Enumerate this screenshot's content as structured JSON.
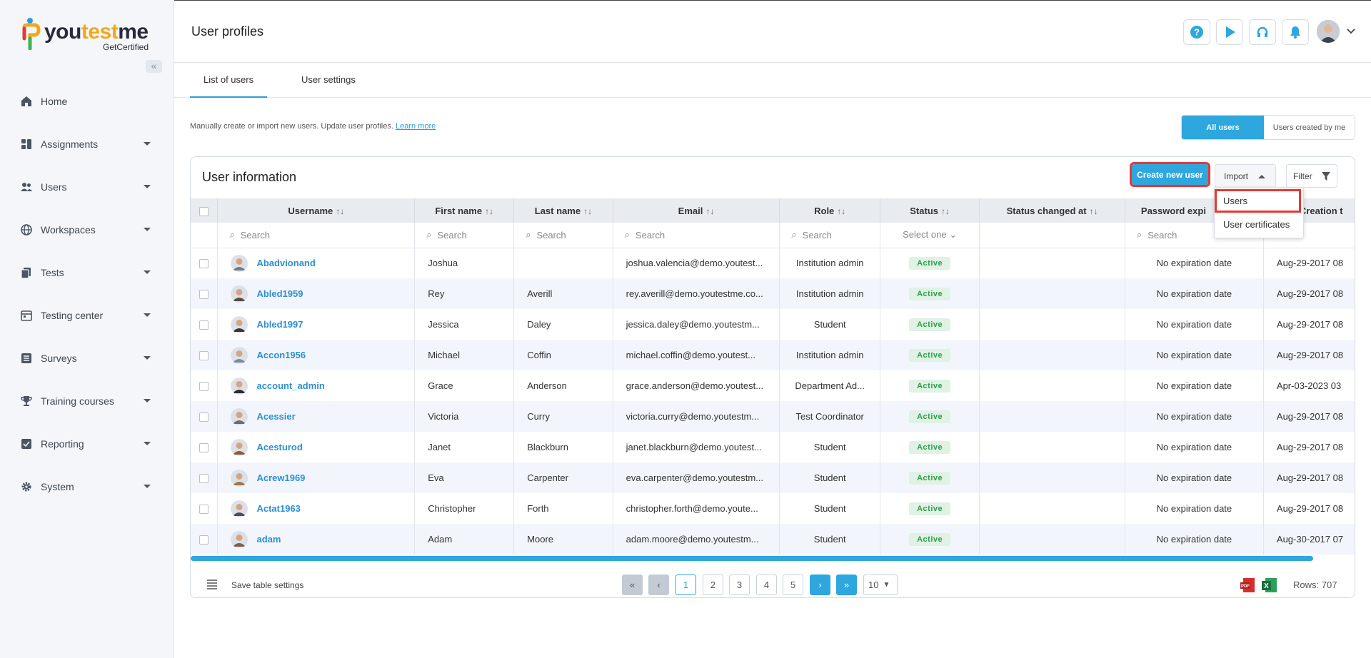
{
  "brand": {
    "word_a": "you",
    "word_b": "test",
    "word_c": "me",
    "sub": "GetCertified"
  },
  "sidebar": {
    "items": [
      {
        "label": "Home",
        "icon": "home-icon",
        "caret": false
      },
      {
        "label": "Assignments",
        "icon": "assignments-icon",
        "caret": true
      },
      {
        "label": "Users",
        "icon": "users-icon",
        "caret": true
      },
      {
        "label": "Workspaces",
        "icon": "globe-icon",
        "caret": true
      },
      {
        "label": "Tests",
        "icon": "tests-icon",
        "caret": true
      },
      {
        "label": "Testing center",
        "icon": "calendar-icon",
        "caret": true
      },
      {
        "label": "Surveys",
        "icon": "list-icon",
        "caret": true
      },
      {
        "label": "Training courses",
        "icon": "trophy-icon",
        "caret": true
      },
      {
        "label": "Reporting",
        "icon": "report-icon",
        "caret": true
      },
      {
        "label": "System",
        "icon": "gear-icon",
        "caret": true
      }
    ]
  },
  "header": {
    "title": "User profiles"
  },
  "tabs": [
    {
      "label": "List of users"
    },
    {
      "label": "User settings"
    }
  ],
  "intro": {
    "text": "Manually create or import new users. Update user profiles.",
    "link": "Learn more"
  },
  "segment": {
    "all": "All users",
    "mine": "Users created by me"
  },
  "card": {
    "title": "User information",
    "create": "Create new user",
    "import": "Import",
    "filter": "Filter"
  },
  "import_menu": {
    "items": [
      "Users",
      "User certificates"
    ]
  },
  "columns": [
    "Username",
    "First name",
    "Last name",
    "Email",
    "Role",
    "Status",
    "Status changed at",
    "Password expi",
    "Creation t"
  ],
  "search": {
    "placeholder": "Search",
    "select": "Select one"
  },
  "rows": [
    {
      "username": "Abadvionand",
      "first": "Joshua",
      "last": "",
      "email": "joshua.valencia@demo.youtest...",
      "role": "Institution admin",
      "status": "Active",
      "pwd": "No expiration date",
      "created": "Aug-29-2017 08"
    },
    {
      "username": "Abled1959",
      "first": "Rey",
      "last": "Averill",
      "email": "rey.averill@demo.youtestme.co...",
      "role": "Institution admin",
      "status": "Active",
      "pwd": "No expiration date",
      "created": "Aug-29-2017 08"
    },
    {
      "username": "Abled1997",
      "first": "Jessica",
      "last": "Daley",
      "email": "jessica.daley@demo.youtestm...",
      "role": "Student",
      "status": "Active",
      "pwd": "No expiration date",
      "created": "Aug-29-2017 08"
    },
    {
      "username": "Accon1956",
      "first": "Michael",
      "last": "Coffin",
      "email": "michael.coffin@demo.youtest...",
      "role": "Institution admin",
      "status": "Active",
      "pwd": "No expiration date",
      "created": "Aug-29-2017 08"
    },
    {
      "username": "account_admin",
      "first": "Grace",
      "last": "Anderson",
      "email": "grace.anderson@demo.youtest...",
      "role": "Department Ad...",
      "status": "Active",
      "pwd": "No expiration date",
      "created": "Apr-03-2023 03"
    },
    {
      "username": "Acessier",
      "first": "Victoria",
      "last": "Curry",
      "email": "victoria.curry@demo.youtestm...",
      "role": "Test Coordinator",
      "status": "Active",
      "pwd": "No expiration date",
      "created": "Aug-29-2017 08"
    },
    {
      "username": "Acesturod",
      "first": "Janet",
      "last": "Blackburn",
      "email": "janet.blackburn@demo.youtest...",
      "role": "Student",
      "status": "Active",
      "pwd": "No expiration date",
      "created": "Aug-29-2017 08"
    },
    {
      "username": "Acrew1969",
      "first": "Eva",
      "last": "Carpenter",
      "email": "eva.carpenter@demo.youtestm...",
      "role": "Student",
      "status": "Active",
      "pwd": "No expiration date",
      "created": "Aug-29-2017 08"
    },
    {
      "username": "Actat1963",
      "first": "Christopher",
      "last": "Forth",
      "email": "christopher.forth@demo.youte...",
      "role": "Student",
      "status": "Active",
      "pwd": "No expiration date",
      "created": "Aug-29-2017 08"
    },
    {
      "username": "adam",
      "first": "Adam",
      "last": "Moore",
      "email": "adam.moore@demo.youtestm...",
      "role": "Student",
      "status": "Active",
      "pwd": "No expiration date",
      "created": "Aug-30-2017 07"
    }
  ],
  "footer": {
    "save": "Save table settings",
    "pages": [
      "1",
      "2",
      "3",
      "4",
      "5"
    ],
    "page_size": "10",
    "rows": "Rows: 707"
  },
  "colors": {
    "accent": "#2ea6de",
    "highlight": "#e53935",
    "active_badge": "#2f9e4e"
  }
}
